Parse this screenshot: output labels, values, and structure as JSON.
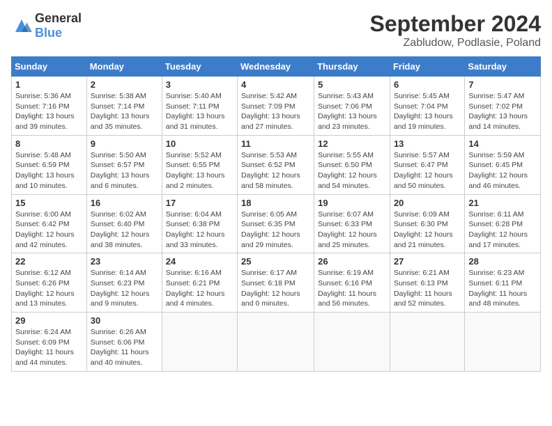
{
  "header": {
    "logo_general": "General",
    "logo_blue": "Blue",
    "title": "September 2024",
    "subtitle": "Zabludow, Podlasie, Poland"
  },
  "calendar": {
    "days_of_week": [
      "Sunday",
      "Monday",
      "Tuesday",
      "Wednesday",
      "Thursday",
      "Friday",
      "Saturday"
    ],
    "weeks": [
      [
        null,
        {
          "day": "2",
          "sunrise": "5:38 AM",
          "sunset": "7:14 PM",
          "daylight": "13 hours and 35 minutes."
        },
        {
          "day": "3",
          "sunrise": "5:40 AM",
          "sunset": "7:11 PM",
          "daylight": "13 hours and 31 minutes."
        },
        {
          "day": "4",
          "sunrise": "5:42 AM",
          "sunset": "7:09 PM",
          "daylight": "13 hours and 27 minutes."
        },
        {
          "day": "5",
          "sunrise": "5:43 AM",
          "sunset": "7:06 PM",
          "daylight": "13 hours and 23 minutes."
        },
        {
          "day": "6",
          "sunrise": "5:45 AM",
          "sunset": "7:04 PM",
          "daylight": "13 hours and 19 minutes."
        },
        {
          "day": "7",
          "sunrise": "5:47 AM",
          "sunset": "7:02 PM",
          "daylight": "13 hours and 14 minutes."
        }
      ],
      [
        {
          "day": "1",
          "sunrise": "5:36 AM",
          "sunset": "7:16 PM",
          "daylight": "13 hours and 39 minutes."
        },
        null,
        null,
        null,
        null,
        null,
        null
      ],
      [
        {
          "day": "8",
          "sunrise": "5:48 AM",
          "sunset": "6:59 PM",
          "daylight": "13 hours and 10 minutes."
        },
        {
          "day": "9",
          "sunrise": "5:50 AM",
          "sunset": "6:57 PM",
          "daylight": "13 hours and 6 minutes."
        },
        {
          "day": "10",
          "sunrise": "5:52 AM",
          "sunset": "6:55 PM",
          "daylight": "13 hours and 2 minutes."
        },
        {
          "day": "11",
          "sunrise": "5:53 AM",
          "sunset": "6:52 PM",
          "daylight": "12 hours and 58 minutes."
        },
        {
          "day": "12",
          "sunrise": "5:55 AM",
          "sunset": "6:50 PM",
          "daylight": "12 hours and 54 minutes."
        },
        {
          "day": "13",
          "sunrise": "5:57 AM",
          "sunset": "6:47 PM",
          "daylight": "12 hours and 50 minutes."
        },
        {
          "day": "14",
          "sunrise": "5:59 AM",
          "sunset": "6:45 PM",
          "daylight": "12 hours and 46 minutes."
        }
      ],
      [
        {
          "day": "15",
          "sunrise": "6:00 AM",
          "sunset": "6:42 PM",
          "daylight": "12 hours and 42 minutes."
        },
        {
          "day": "16",
          "sunrise": "6:02 AM",
          "sunset": "6:40 PM",
          "daylight": "12 hours and 38 minutes."
        },
        {
          "day": "17",
          "sunrise": "6:04 AM",
          "sunset": "6:38 PM",
          "daylight": "12 hours and 33 minutes."
        },
        {
          "day": "18",
          "sunrise": "6:05 AM",
          "sunset": "6:35 PM",
          "daylight": "12 hours and 29 minutes."
        },
        {
          "day": "19",
          "sunrise": "6:07 AM",
          "sunset": "6:33 PM",
          "daylight": "12 hours and 25 minutes."
        },
        {
          "day": "20",
          "sunrise": "6:09 AM",
          "sunset": "6:30 PM",
          "daylight": "12 hours and 21 minutes."
        },
        {
          "day": "21",
          "sunrise": "6:11 AM",
          "sunset": "6:28 PM",
          "daylight": "12 hours and 17 minutes."
        }
      ],
      [
        {
          "day": "22",
          "sunrise": "6:12 AM",
          "sunset": "6:26 PM",
          "daylight": "12 hours and 13 minutes."
        },
        {
          "day": "23",
          "sunrise": "6:14 AM",
          "sunset": "6:23 PM",
          "daylight": "12 hours and 9 minutes."
        },
        {
          "day": "24",
          "sunrise": "6:16 AM",
          "sunset": "6:21 PM",
          "daylight": "12 hours and 4 minutes."
        },
        {
          "day": "25",
          "sunrise": "6:17 AM",
          "sunset": "6:18 PM",
          "daylight": "12 hours and 0 minutes."
        },
        {
          "day": "26",
          "sunrise": "6:19 AM",
          "sunset": "6:16 PM",
          "daylight": "11 hours and 56 minutes."
        },
        {
          "day": "27",
          "sunrise": "6:21 AM",
          "sunset": "6:13 PM",
          "daylight": "11 hours and 52 minutes."
        },
        {
          "day": "28",
          "sunrise": "6:23 AM",
          "sunset": "6:11 PM",
          "daylight": "11 hours and 48 minutes."
        }
      ],
      [
        {
          "day": "29",
          "sunrise": "6:24 AM",
          "sunset": "6:09 PM",
          "daylight": "11 hours and 44 minutes."
        },
        {
          "day": "30",
          "sunrise": "6:26 AM",
          "sunset": "6:06 PM",
          "daylight": "11 hours and 40 minutes."
        },
        null,
        null,
        null,
        null,
        null
      ]
    ]
  }
}
